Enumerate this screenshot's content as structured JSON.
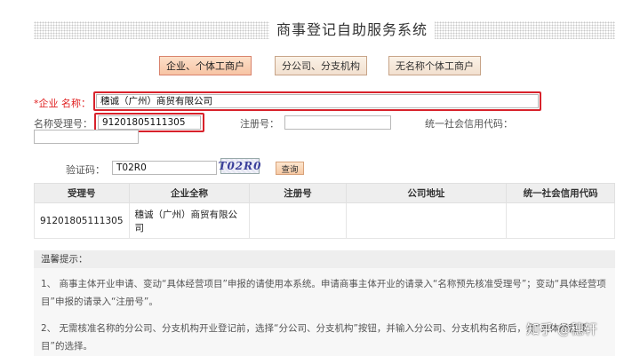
{
  "header": {
    "title": "商事登记自助服务系统"
  },
  "categories": [
    {
      "label": "企业、个体工商户",
      "active": true
    },
    {
      "label": "分公司、分支机构",
      "active": false
    },
    {
      "label": "无名称个体工商户",
      "active": false
    }
  ],
  "form": {
    "enterprise_name": {
      "required_mark": "*",
      "label": "企业 名称：",
      "value": "穗诚（广州）商贸有限公司"
    },
    "acceptance_no": {
      "label": "名称受理号：",
      "value": "91201805111305"
    },
    "registration_no": {
      "label": "注册号：",
      "value": ""
    },
    "credit_code": {
      "label": "统一社会信用代码：",
      "value": ""
    },
    "captcha": {
      "label": "验证码：",
      "value": "T02R0",
      "image_text": "T02R0"
    },
    "query_label": "查询"
  },
  "table": {
    "headers": [
      "受理号",
      "企业全称",
      "注册号",
      "公司地址",
      "统一社会信用代码"
    ],
    "rows": [
      [
        "91201805111305",
        "穗诚（广州）商贸有限公司",
        "",
        "",
        ""
      ]
    ]
  },
  "tips": {
    "heading": "温馨提示：",
    "items": [
      "1、 商事主体开业申请、变动“具体经营项目”申报的请使用本系统。申请商事主体开业的请录入“名称预先核准受理号”；变动“具体经营项目”申报的请录入“注册号”。",
      "2、 无需核准名称的分公司、分支机构开业登记前，选择“分公司、分支机构”按钮，并输入分公司、分支机构名称后，点“具体经营项目”的选择。"
    ]
  },
  "watermark": "知乎 @穗轩",
  "colors": {
    "highlight_border": "#d8222b",
    "active_tab": "#f7c4a4",
    "required": "#e02020"
  }
}
